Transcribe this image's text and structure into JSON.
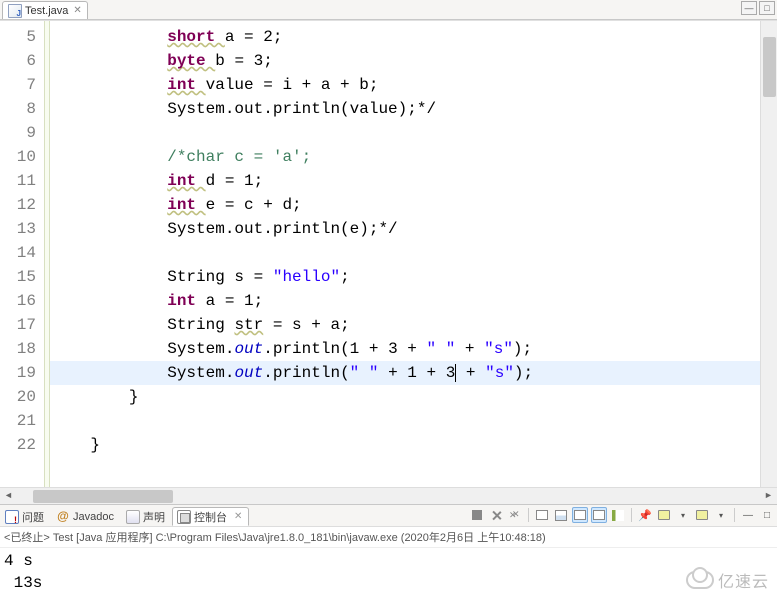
{
  "tabs": {
    "editor": {
      "label": "Test.java"
    }
  },
  "code": {
    "lines": [
      {
        "num": 5,
        "indent": "            ",
        "tokens": [
          {
            "t": "short ",
            "c": "kw u"
          },
          {
            "t": "a"
          },
          {
            "t": " = 2;"
          }
        ]
      },
      {
        "num": 6,
        "indent": "            ",
        "tokens": [
          {
            "t": "byte ",
            "c": "kw u"
          },
          {
            "t": "b"
          },
          {
            "t": " = 3;"
          }
        ]
      },
      {
        "num": 7,
        "indent": "            ",
        "tokens": [
          {
            "t": "int ",
            "c": "kw u"
          },
          {
            "t": "value"
          },
          {
            "t": " = i + a + b;"
          }
        ]
      },
      {
        "num": 8,
        "indent": "            ",
        "tokens": [
          {
            "t": "System.out.println(value);*/"
          }
        ]
      },
      {
        "num": 9,
        "indent": "",
        "tokens": []
      },
      {
        "num": 10,
        "indent": "            ",
        "tokens": [
          {
            "t": "/*char c = 'a';",
            "c": "com"
          }
        ]
      },
      {
        "num": 11,
        "indent": "            ",
        "tokens": [
          {
            "t": "int ",
            "c": "kw u"
          },
          {
            "t": "d"
          },
          {
            "t": " = 1;"
          }
        ]
      },
      {
        "num": 12,
        "indent": "            ",
        "tokens": [
          {
            "t": "int ",
            "c": "kw u"
          },
          {
            "t": "e"
          },
          {
            "t": " = c + d;"
          }
        ]
      },
      {
        "num": 13,
        "indent": "            ",
        "tokens": [
          {
            "t": "System.out.println(e);*/"
          }
        ]
      },
      {
        "num": 14,
        "indent": "",
        "tokens": []
      },
      {
        "num": 15,
        "indent": "            ",
        "tokens": [
          {
            "t": "String s = "
          },
          {
            "t": "\"hello\"",
            "c": "str"
          },
          {
            "t": ";"
          }
        ]
      },
      {
        "num": 16,
        "indent": "            ",
        "tokens": [
          {
            "t": "int",
            "c": "kw"
          },
          {
            "t": " a = 1;"
          }
        ]
      },
      {
        "num": 17,
        "indent": "            ",
        "tokens": [
          {
            "t": "String "
          },
          {
            "t": "str",
            "c": "under"
          },
          {
            "t": " = s + a;"
          }
        ]
      },
      {
        "num": 18,
        "indent": "            ",
        "tokens": [
          {
            "t": "System."
          },
          {
            "t": "out",
            "c": "sfield"
          },
          {
            "t": ".println(1 + 3 + "
          },
          {
            "t": "\" \"",
            "c": "str"
          },
          {
            "t": " + "
          },
          {
            "t": "\"s\"",
            "c": "str"
          },
          {
            "t": ");"
          }
        ]
      },
      {
        "num": 19,
        "hl": true,
        "indent": "            ",
        "tokens": [
          {
            "t": "System."
          },
          {
            "t": "out",
            "c": "sfield"
          },
          {
            "t": ".println("
          },
          {
            "t": "\" \"",
            "c": "str"
          },
          {
            "t": " + 1 + 3"
          },
          {
            "t": "",
            "caret": true
          },
          {
            "t": " + "
          },
          {
            "t": "\"s\"",
            "c": "str"
          },
          {
            "t": ");"
          }
        ]
      },
      {
        "num": 20,
        "indent": "        ",
        "tokens": [
          {
            "t": "}"
          }
        ]
      },
      {
        "num": 21,
        "indent": "",
        "tokens": []
      },
      {
        "num": 22,
        "indent": "    ",
        "tokens": [
          {
            "t": "}"
          }
        ]
      }
    ]
  },
  "bottom_tabs": {
    "problems": "问题",
    "javadoc": "Javadoc",
    "declaration": "声明",
    "console": "控制台"
  },
  "console": {
    "header_prefix": "<已终止> ",
    "header_main": "Test [Java 应用程序] C:\\Program Files\\Java\\jre1.8.0_181\\bin\\javaw.exe  (2020年2月6日 上午10:48:18)",
    "output_line1": "4 s",
    "output_line2": " 13s"
  },
  "watermark": "亿速云"
}
